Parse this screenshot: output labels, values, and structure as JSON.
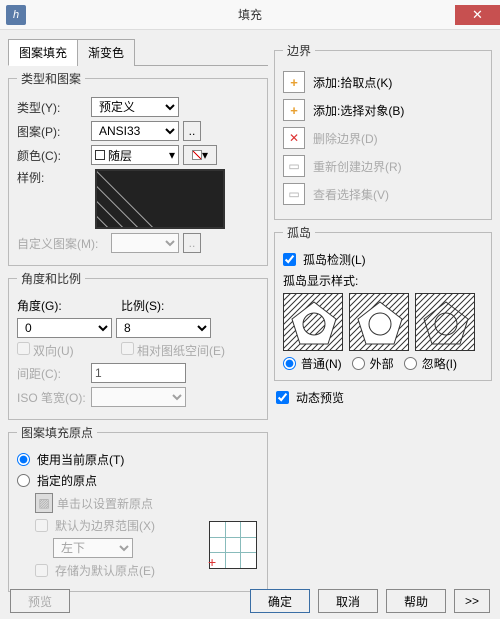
{
  "window": {
    "title": "填充",
    "icon": "h"
  },
  "tabs": {
    "hatch": "图案填充",
    "gradient": "渐变色"
  },
  "typeGroup": {
    "legend": "类型和图案",
    "typeLabel": "类型(Y):",
    "typeValue": "预定义",
    "patternLabel": "图案(P):",
    "patternValue": "ANSI33",
    "colorLabel": "颜色(C):",
    "colorValue": "随层",
    "sampleLabel": "样例:",
    "customLabel": "自定义图案(M):"
  },
  "angleGroup": {
    "legend": "角度和比例",
    "angleLabel": "角度(G):",
    "angleValue": "0",
    "scaleLabel": "比例(S):",
    "scaleValue": "8",
    "doubleLabel": "双向(U)",
    "relPaperLabel": "相对图纸空间(E)",
    "spacingLabel": "间距(C):",
    "spacingValue": "1",
    "isoLabel": "ISO 笔宽(O):"
  },
  "originGroup": {
    "legend": "图案填充原点",
    "useCurrent": "使用当前原点(T)",
    "specified": "指定的原点",
    "clickSet": "单击以设置新原点",
    "defaultExtent": "默认为边界范围(X)",
    "posValue": "左下",
    "storeDefault": "存储为默认原点(E)"
  },
  "boundary": {
    "legend": "边界",
    "addPick": "添加:拾取点(K)",
    "addSelect": "添加:选择对象(B)",
    "remove": "删除边界(D)",
    "recreate": "重新创建边界(R)",
    "viewSel": "查看选择集(V)"
  },
  "island": {
    "legend": "孤岛",
    "detect": "孤岛检测(L)",
    "styleLabel": "孤岛显示样式:",
    "normal": "普通(N)",
    "outer": "外部",
    "ignore": "忽略(I)"
  },
  "preview": "动态预览",
  "footer": {
    "previewBtn": "预览",
    "ok": "确定",
    "cancel": "取消",
    "help": "帮助",
    "expand": ">>"
  }
}
